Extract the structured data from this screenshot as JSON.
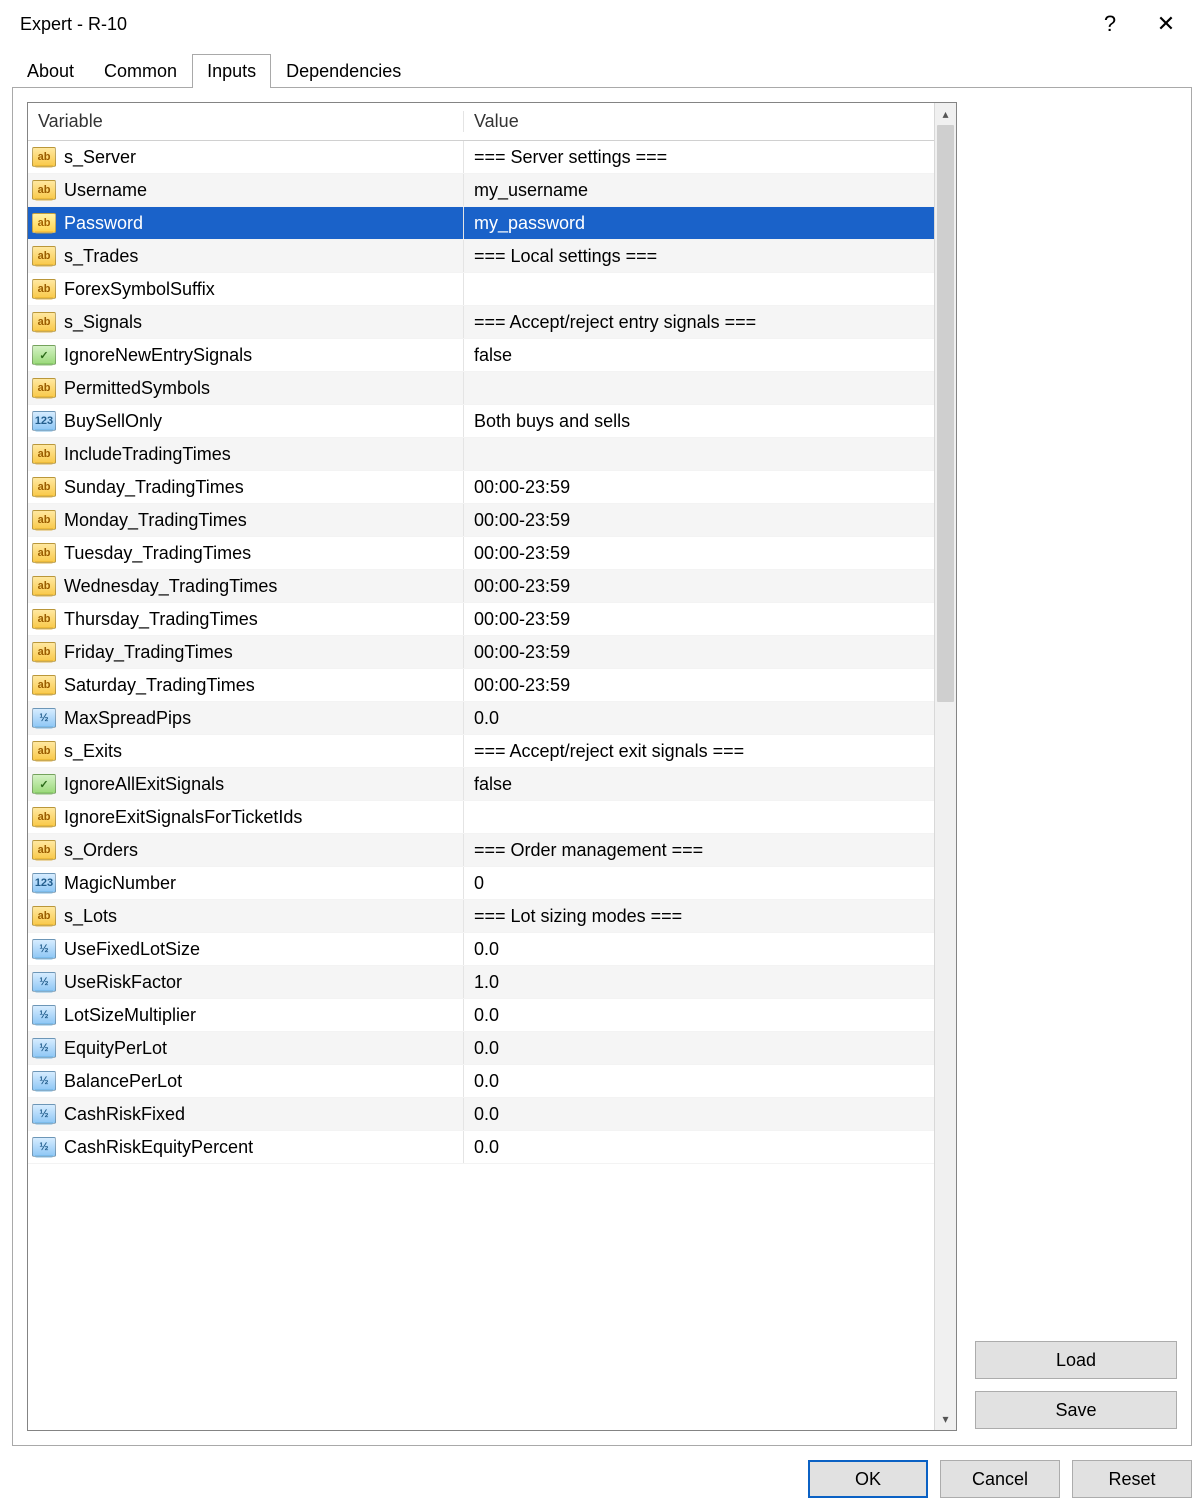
{
  "window": {
    "title": "Expert - R-10",
    "help_glyph": "?",
    "close_glyph": "✕"
  },
  "tabs": [
    {
      "label": "About",
      "active": false
    },
    {
      "label": "Common",
      "active": false
    },
    {
      "label": "Inputs",
      "active": true
    },
    {
      "label": "Dependencies",
      "active": false
    }
  ],
  "grid": {
    "header_variable": "Variable",
    "header_value": "Value",
    "scroll_up_glyph": "▴",
    "scroll_down_glyph": "▾",
    "selected_index": 2,
    "icon_labels": {
      "str": "ab",
      "bool": "✓",
      "int": "123",
      "dbl": "½"
    },
    "rows": [
      {
        "type": "str",
        "variable": "s_Server",
        "value": "=== Server settings ==="
      },
      {
        "type": "str",
        "variable": "Username",
        "value": "my_username"
      },
      {
        "type": "str",
        "variable": "Password",
        "value": "my_password"
      },
      {
        "type": "str",
        "variable": "s_Trades",
        "value": "=== Local settings ==="
      },
      {
        "type": "str",
        "variable": "ForexSymbolSuffix",
        "value": ""
      },
      {
        "type": "str",
        "variable": "s_Signals",
        "value": "=== Accept/reject entry signals ==="
      },
      {
        "type": "bool",
        "variable": "IgnoreNewEntrySignals",
        "value": "false"
      },
      {
        "type": "str",
        "variable": "PermittedSymbols",
        "value": ""
      },
      {
        "type": "int",
        "variable": "BuySellOnly",
        "value": "Both buys and sells"
      },
      {
        "type": "str",
        "variable": "IncludeTradingTimes",
        "value": ""
      },
      {
        "type": "str",
        "variable": "Sunday_TradingTimes",
        "value": "00:00-23:59"
      },
      {
        "type": "str",
        "variable": "Monday_TradingTimes",
        "value": "00:00-23:59"
      },
      {
        "type": "str",
        "variable": "Tuesday_TradingTimes",
        "value": "00:00-23:59"
      },
      {
        "type": "str",
        "variable": "Wednesday_TradingTimes",
        "value": "00:00-23:59"
      },
      {
        "type": "str",
        "variable": "Thursday_TradingTimes",
        "value": "00:00-23:59"
      },
      {
        "type": "str",
        "variable": "Friday_TradingTimes",
        "value": "00:00-23:59"
      },
      {
        "type": "str",
        "variable": "Saturday_TradingTimes",
        "value": "00:00-23:59"
      },
      {
        "type": "dbl",
        "variable": "MaxSpreadPips",
        "value": "0.0"
      },
      {
        "type": "str",
        "variable": "s_Exits",
        "value": "=== Accept/reject exit signals ==="
      },
      {
        "type": "bool",
        "variable": "IgnoreAllExitSignals",
        "value": "false"
      },
      {
        "type": "str",
        "variable": "IgnoreExitSignalsForTicketIds",
        "value": ""
      },
      {
        "type": "str",
        "variable": "s_Orders",
        "value": "=== Order management ==="
      },
      {
        "type": "int",
        "variable": "MagicNumber",
        "value": "0"
      },
      {
        "type": "str",
        "variable": "s_Lots",
        "value": "=== Lot sizing modes ==="
      },
      {
        "type": "dbl",
        "variable": "UseFixedLotSize",
        "value": "0.0"
      },
      {
        "type": "dbl",
        "variable": "UseRiskFactor",
        "value": "1.0"
      },
      {
        "type": "dbl",
        "variable": "LotSizeMultiplier",
        "value": "0.0"
      },
      {
        "type": "dbl",
        "variable": "EquityPerLot",
        "value": "0.0"
      },
      {
        "type": "dbl",
        "variable": "BalancePerLot",
        "value": "0.0"
      },
      {
        "type": "dbl",
        "variable": "CashRiskFixed",
        "value": "0.0"
      },
      {
        "type": "dbl",
        "variable": "CashRiskEquityPercent",
        "value": "0.0"
      }
    ]
  },
  "buttons": {
    "load": "Load",
    "save": "Save",
    "ok": "OK",
    "cancel": "Cancel",
    "reset": "Reset"
  }
}
